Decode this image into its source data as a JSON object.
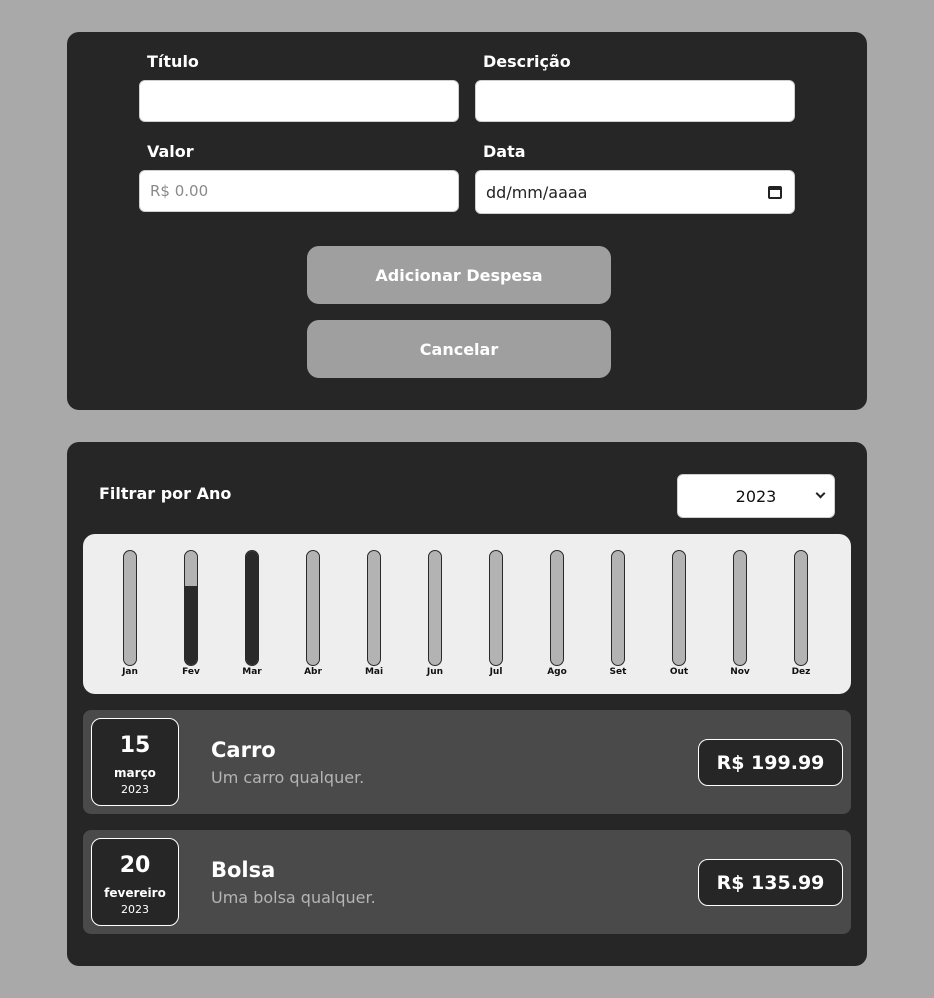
{
  "form": {
    "title_label": "Título",
    "title_value": "",
    "description_label": "Descrição",
    "description_value": "",
    "value_label": "Valor",
    "value_placeholder": "R$ 0.00",
    "date_label": "Data",
    "date_placeholder": "dd/mm/aaaa",
    "date_icon": "calendar-icon",
    "add_button": "Adicionar Despesa",
    "cancel_button": "Cancelar"
  },
  "filter": {
    "label": "Filtrar por Ano",
    "selected_year": "2023",
    "chevron_icon": "chevron-down-icon"
  },
  "chart_data": {
    "type": "bar",
    "categories": [
      "Jan",
      "Fev",
      "Mar",
      "Abr",
      "Mai",
      "Jun",
      "Jul",
      "Ago",
      "Set",
      "Out",
      "Nov",
      "Dez"
    ],
    "values": [
      0,
      135.99,
      199.99,
      0,
      0,
      0,
      0,
      0,
      0,
      0,
      0,
      0
    ],
    "ylim": [
      0,
      199.99
    ]
  },
  "expenses": [
    {
      "day": "15",
      "month": "março",
      "year": "2023",
      "title": "Carro",
      "description": "Um carro qualquer.",
      "amount": "R$ 199.99"
    },
    {
      "day": "20",
      "month": "fevereiro",
      "year": "2023",
      "title": "Bolsa",
      "description": "Uma bolsa qualquer.",
      "amount": "R$ 135.99"
    }
  ],
  "colors": {
    "page_background": "#a9a9a9",
    "panel_background": "#262626",
    "card_background": "#4a4a4a",
    "button_background": "#9f9f9f",
    "chart_background": "#eeeeee",
    "bar_fill": "#2a2a2a",
    "bar_track": "#b3b3b3"
  }
}
